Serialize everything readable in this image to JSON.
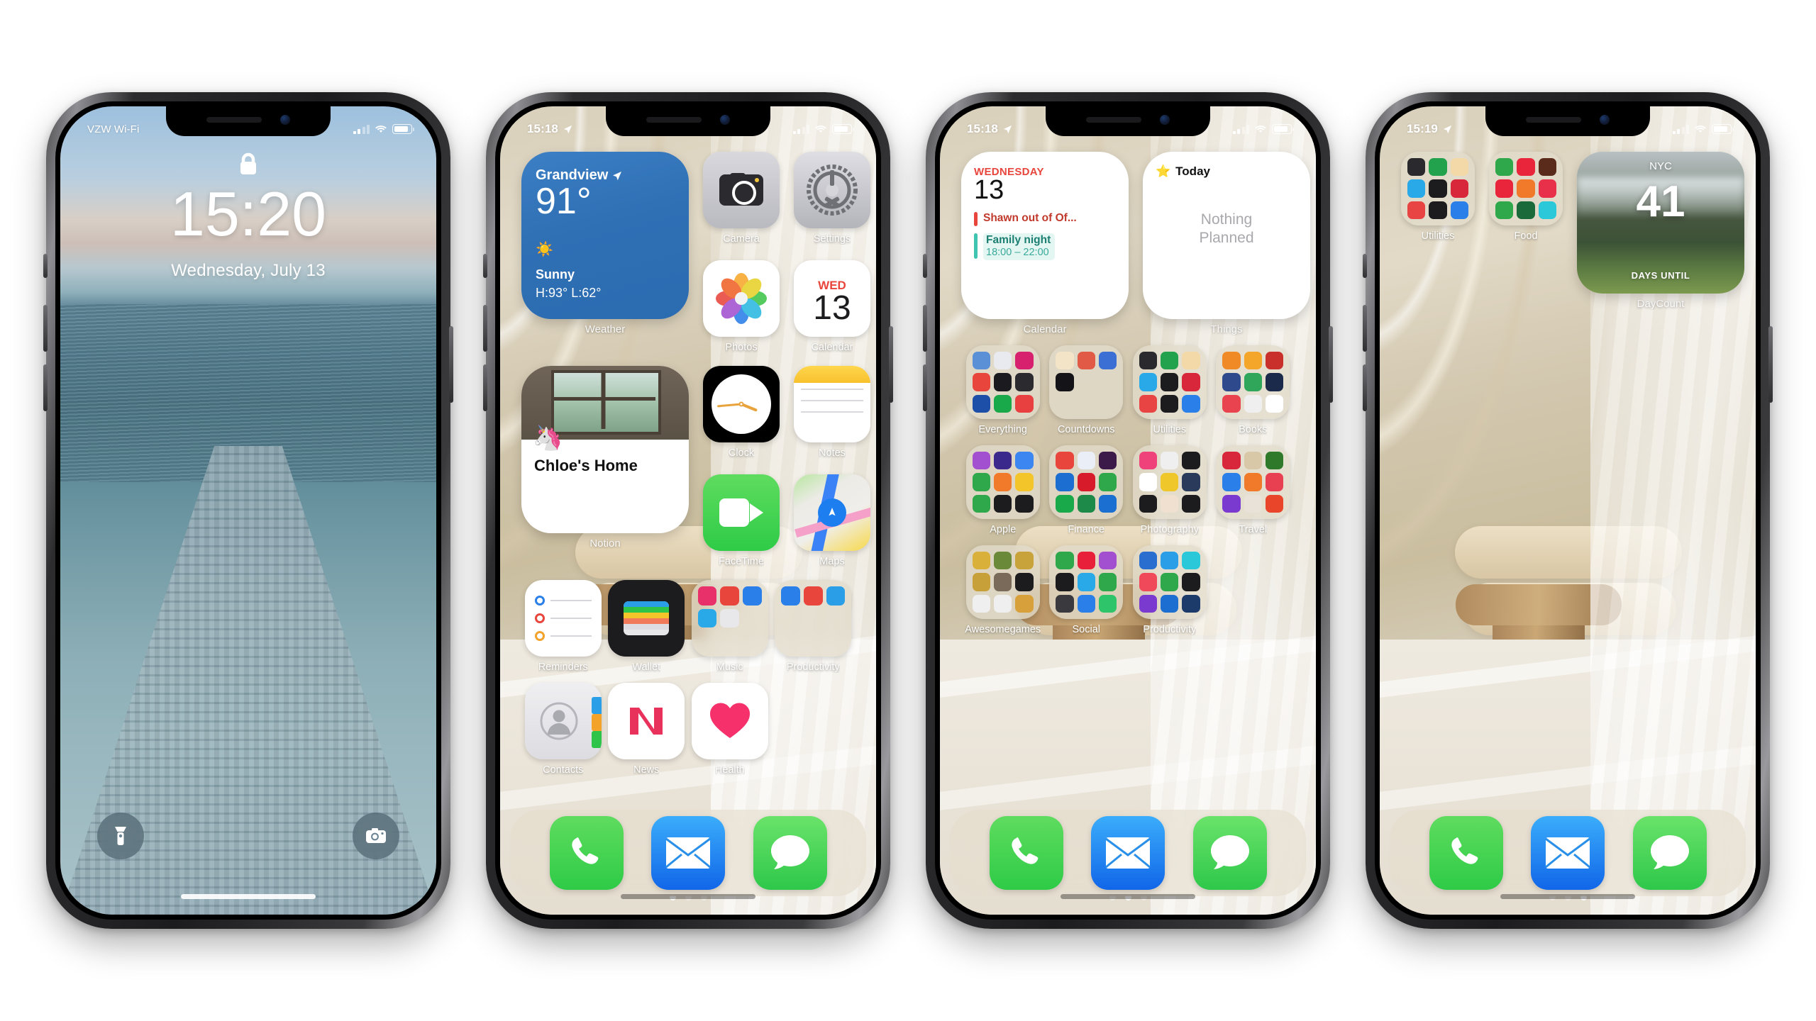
{
  "phones": [
    {
      "id": "lock-screen",
      "type": "lock",
      "status_bar": {
        "carrier": "VZW Wi-Fi",
        "time": "",
        "battery": "86"
      },
      "lock": {
        "time": "15:20",
        "date": "Wednesday, July 13",
        "lock_icon": "lock-icon",
        "flashlight_label": "flashlight-icon",
        "camera_label": "camera-icon"
      }
    },
    {
      "id": "home-page-1",
      "type": "home",
      "status_bar": {
        "time": "15:18",
        "location": "location-arrow-icon"
      },
      "widgets": [
        {
          "name": "Weather",
          "label": "Weather",
          "city": "Grandview",
          "temp": "91°",
          "condition": "Sunny",
          "high_low": "H:93° L:62°",
          "icon": "sun-icon",
          "accent": "#2f6fb4"
        },
        {
          "name": "Notion",
          "label": "Notion",
          "title": "Chloe's Home",
          "emoji": "🦄"
        }
      ],
      "apps": [
        {
          "label": "Camera",
          "icon": "camera-icon"
        },
        {
          "label": "Settings",
          "icon": "gear-icon"
        },
        {
          "label": "Photos",
          "icon": "photos-icon"
        },
        {
          "label": "Calendar",
          "icon": "calendar-icon",
          "dow": "WED",
          "day": "13"
        },
        {
          "label": "Clock",
          "icon": "clock-icon"
        },
        {
          "label": "Notes",
          "icon": "notes-icon"
        },
        {
          "label": "FaceTime",
          "icon": "facetime-icon"
        },
        {
          "label": "Maps",
          "icon": "maps-icon"
        },
        {
          "label": "Reminders",
          "icon": "reminders-icon"
        },
        {
          "label": "Wallet",
          "icon": "wallet-icon"
        },
        {
          "label": "Music",
          "icon": "folder-icon"
        },
        {
          "label": "Productivity",
          "icon": "folder-icon"
        },
        {
          "label": "Contacts",
          "icon": "contacts-icon"
        },
        {
          "label": "News",
          "icon": "news-icon"
        },
        {
          "label": "Health",
          "icon": "heart-icon"
        }
      ],
      "page_dots": {
        "count": 3,
        "active": 0
      },
      "dock": [
        {
          "label": "Phone",
          "icon": "phone-icon"
        },
        {
          "label": "Mail",
          "icon": "mail-icon"
        },
        {
          "label": "Messages",
          "icon": "message-icon"
        }
      ]
    },
    {
      "id": "home-page-2",
      "type": "home",
      "status_bar": {
        "time": "15:18",
        "location": "location-arrow-icon"
      },
      "widgets": [
        {
          "name": "Calendar",
          "label": "Calendar",
          "dow": "WEDNESDAY",
          "day": "13",
          "events": [
            {
              "title": "Shawn out of Of...",
              "time": "",
              "color": "#e8453c"
            },
            {
              "title": "Family night",
              "time": "18:00 – 22:00",
              "color": "#3ec4b0"
            }
          ]
        },
        {
          "name": "Things",
          "label": "Things",
          "header": "Today",
          "header_icon": "star-icon",
          "empty_text": "Nothing\nPlanned",
          "empty_line1": "Nothing",
          "empty_line2": "Planned"
        }
      ],
      "folders": [
        {
          "label": "Everything"
        },
        {
          "label": "Countdowns"
        },
        {
          "label": "Utilities"
        },
        {
          "label": "Books"
        },
        {
          "label": "Apple"
        },
        {
          "label": "Finance"
        },
        {
          "label": "Photography"
        },
        {
          "label": "Travel"
        },
        {
          "label": "Awesomegames"
        },
        {
          "label": "Social"
        },
        {
          "label": "Productivity"
        }
      ],
      "page_dots": {
        "count": 3,
        "active": 1
      },
      "dock": [
        {
          "label": "Phone",
          "icon": "phone-icon"
        },
        {
          "label": "Mail",
          "icon": "mail-icon"
        },
        {
          "label": "Messages",
          "icon": "message-icon"
        }
      ]
    },
    {
      "id": "home-page-3",
      "type": "home",
      "status_bar": {
        "time": "15:19",
        "location": "location-arrow-icon"
      },
      "folders": [
        {
          "label": "Utilities"
        },
        {
          "label": "Food"
        }
      ],
      "widgets": [
        {
          "name": "DayCount",
          "label": "DayCount",
          "place": "NYC",
          "count": "41",
          "caption": "DAYS UNTIL"
        }
      ],
      "page_dots": {
        "count": 3,
        "active": 2
      },
      "dock": [
        {
          "label": "Phone",
          "icon": "phone-icon"
        },
        {
          "label": "Mail",
          "icon": "mail-icon"
        },
        {
          "label": "Messages",
          "icon": "message-icon"
        }
      ]
    }
  ],
  "folder_swatches": {
    "Everything": [
      "#5b8fd6",
      "#e8eaf0",
      "#d8216e",
      "#e8453c",
      "#1b1b1f",
      "#2b2b2f",
      "#1d4fa8",
      "#19a84a",
      "#e84040"
    ],
    "Countdowns": [
      "#f3e4c8",
      "#e05a46",
      "#3b6fd4",
      "#141418",
      "",
      ""
    ],
    "Utilities": [
      "#2a2a2e",
      "#23a24d",
      "#f3d9a8",
      "#2aa9e8",
      "#1c1c1e",
      "#d8263a",
      "#e84444",
      "#1c1c1e",
      "#2a7fe8"
    ],
    "Books": [
      "#f08a26",
      "#f4a62a",
      "#c9302c",
      "#2e4a8c",
      "#2fa65a",
      "#1b2a4a",
      "#e8434f",
      "#efefef",
      "#ffffff"
    ],
    "Apple": [
      "#a24fd0",
      "#3b2a8c",
      "#3b86f0",
      "#2ea84a",
      "#f07a2a",
      "#f3c52a",
      "#2ea84a",
      "#1c1c1e",
      "#1c1c1e"
    ],
    "Finance": [
      "#e8453c",
      "#e9eef7",
      "#3b1a4a",
      "#1c6fd0",
      "#d81b2a",
      "#2ea84a",
      "#19a84a",
      "#1e8a4a",
      "#1a6fd0"
    ],
    "Photography": [
      "#f0427a",
      "#efefef",
      "#1c1c1e",
      "#ffffff",
      "#f0c72a",
      "#2a3a5a",
      "#1c1c1e",
      "#f0e0d0",
      "#1c1c1e"
    ],
    "Travel": [
      "#d8263a",
      "#d8c8a8",
      "#2e7a2a",
      "#2a7fe8",
      "#f07a2a",
      "#e84050",
      "#7a3ad0",
      "#e8e2d8",
      "#e8452a"
    ],
    "Awesomegames": [
      "#d8b03a",
      "#6a8a3a",
      "#c8a23a",
      "#c8a03a",
      "#7a6a5a",
      "#1c1c1e",
      "#efefef",
      "#efefef",
      "#d8a03a"
    ],
    "Social": [
      "#2ea84a",
      "#e8203a",
      "#a24fd0",
      "#1c1c1e",
      "#2aa9e8",
      "#2ea84a",
      "#3a3a3e",
      "#2a7fe8",
      "#2ec46a"
    ],
    "Productivity": [
      "#2a6fd0",
      "#2a9fe8",
      "#2ac8d8",
      "#f04a5a",
      "#2ea84a",
      "#1c1c1e",
      "#7a3ad0",
      "#1c6fd0",
      "#1c3a6a"
    ],
    "Food": [
      "#2ea84a",
      "#e8253a",
      "#5a2a1a",
      "#e8253a",
      "#f07a2a",
      "#e8304a",
      "#2ea84a",
      "#1a6a3a",
      "#2ac8d8"
    ],
    "Music": [
      "#e8306a",
      "#e8453c",
      "#2a7fe8",
      "#2aa9e8",
      "#e8e8ea",
      "",
      ""
    ],
    "MusicFolder": [
      "#e8306a",
      "#e8453c",
      "#2a9fe8",
      "#2ac4e8",
      "#e0e0e4"
    ],
    "ProdFolder": [
      "#2a7fe8",
      "#e8453c",
      "#2a9fe8"
    ]
  }
}
